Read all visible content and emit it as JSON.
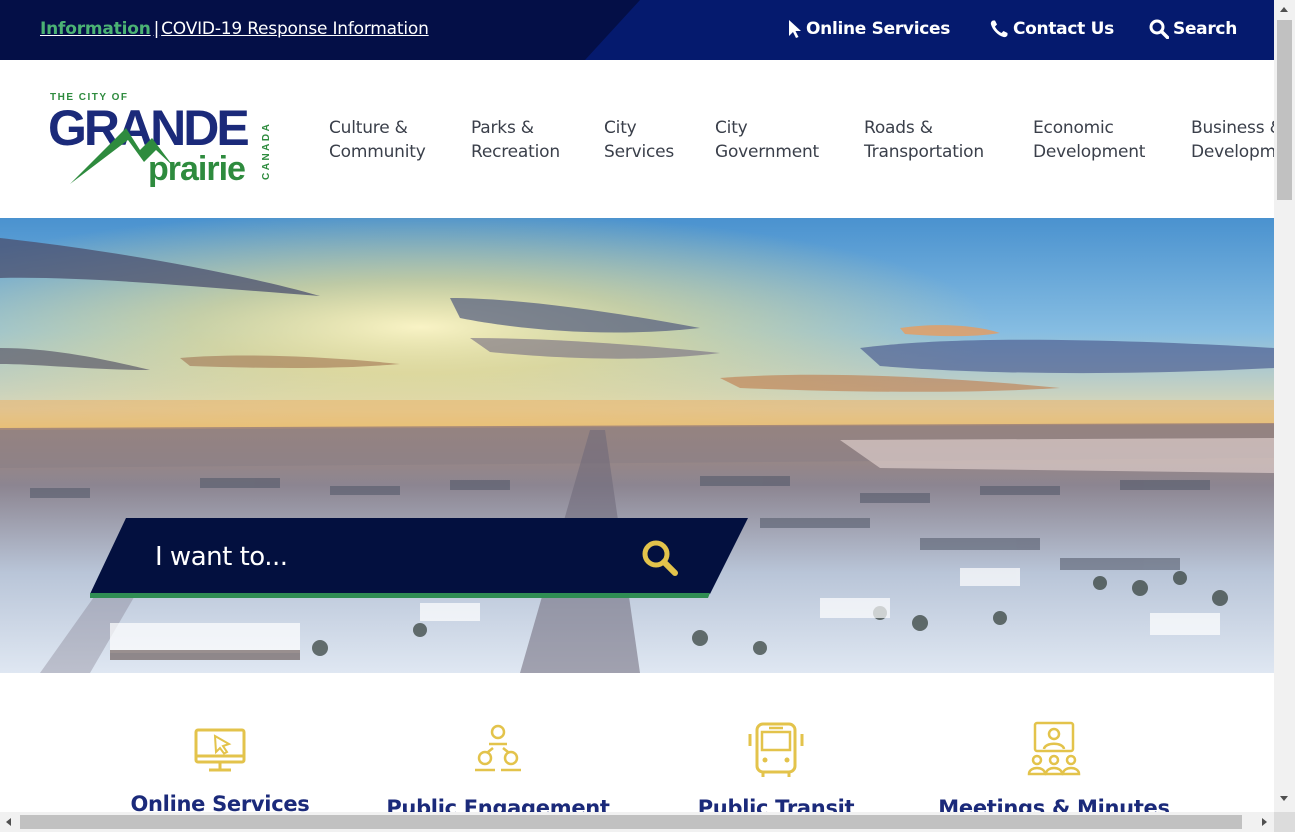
{
  "alert": {
    "label": "Information",
    "separator": "|",
    "text": "COVID-19 Response Information"
  },
  "utility_nav": {
    "online_services": "Online Services",
    "contact_us": "Contact Us",
    "search": "Search"
  },
  "logo": {
    "line1": "THE CITY OF",
    "line2": "GRANDE",
    "line3": "prairie",
    "side": "CANADA"
  },
  "nav": [
    {
      "line1": "Culture &",
      "line2": "Community"
    },
    {
      "line1": "Parks &",
      "line2": "Recreation"
    },
    {
      "line1": "City",
      "line2": "Services"
    },
    {
      "line1": "City",
      "line2": "Government"
    },
    {
      "line1": "Roads &",
      "line2": "Transportation"
    },
    {
      "line1": "Economic",
      "line2": "Development"
    },
    {
      "line1": "Business &",
      "line2": "Development"
    }
  ],
  "hero": {
    "search_placeholder": "I want to..."
  },
  "quick_links": [
    {
      "label": "Online Services",
      "icon": "computer-cursor-icon"
    },
    {
      "label": "Public Engagement",
      "icon": "people-network-icon"
    },
    {
      "label": "Public Transit",
      "icon": "bus-icon"
    },
    {
      "label": "Meetings & Minutes",
      "icon": "video-meeting-icon"
    }
  ],
  "colors": {
    "navy": "#040f47",
    "royal_blue": "#051a6e",
    "green": "#4bb274",
    "gold": "#e3c34b",
    "link_blue": "#1b2a7a"
  }
}
